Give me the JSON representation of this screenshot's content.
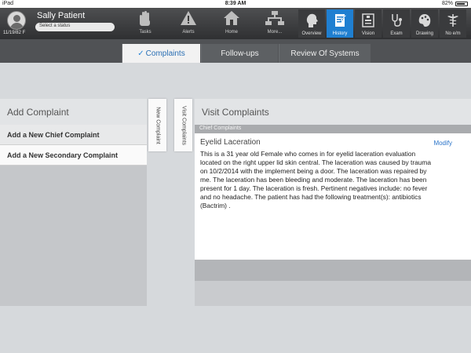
{
  "status_bar": {
    "device": "iPad",
    "time": "8:39 AM",
    "battery": "82%"
  },
  "patient": {
    "name": "Sally  Patient",
    "dob": "11/19/82 F",
    "status_placeholder": "Select a status"
  },
  "main_nav": [
    {
      "label": "Tasks",
      "icon": "hand-icon"
    },
    {
      "label": "Alerts",
      "icon": "warning-icon"
    },
    {
      "label": "Home",
      "icon": "home-icon"
    },
    {
      "label": "More...",
      "icon": "sitemap-icon"
    }
  ],
  "tab_nav": [
    {
      "label": "Overview",
      "icon": "head-profile-icon"
    },
    {
      "label": "History",
      "icon": "history-icon",
      "active": true
    },
    {
      "label": "Vision",
      "icon": "eye-chart-icon"
    },
    {
      "label": "Exam",
      "icon": "stethoscope-icon"
    },
    {
      "label": "Drawing",
      "icon": "palette-icon"
    },
    {
      "label": "No e/m",
      "icon": "caduceus-icon"
    }
  ],
  "segments": [
    {
      "label": "Complaints",
      "active": true
    },
    {
      "label": "Follow-ups"
    },
    {
      "label": "Review Of Systems"
    }
  ],
  "left_panel": {
    "title": "Add Complaint",
    "items": [
      "Add a New Chief Complaint",
      "Add a New Secondary Complaint"
    ]
  },
  "vertical_tabs": [
    "New Complaint",
    "Visit Complaints"
  ],
  "right_panel": {
    "title": "Visit Complaints",
    "section": "Chief Complaints",
    "complaint_title": "Eyelid Laceration",
    "modify_label": "Modify",
    "complaint_text": "This is a 31 year old Female who comes in for eyelid laceration evaluation located on the right upper lid skin central. The laceration was caused by trauma on 10/2/2014 with the implement being a door. The laceration was repaired by me. The laceration has been  bleeding and moderate. The laceration has been present for 1 day. The laceration is fresh. Pertinent negatives include: no fever and no headache. The patient has had the following treatment(s): antibiotics (Bactrim) ."
  },
  "colors": {
    "accent": "#1f7fd1",
    "header_dark": "#2f3032",
    "link": "#2a74c9"
  }
}
